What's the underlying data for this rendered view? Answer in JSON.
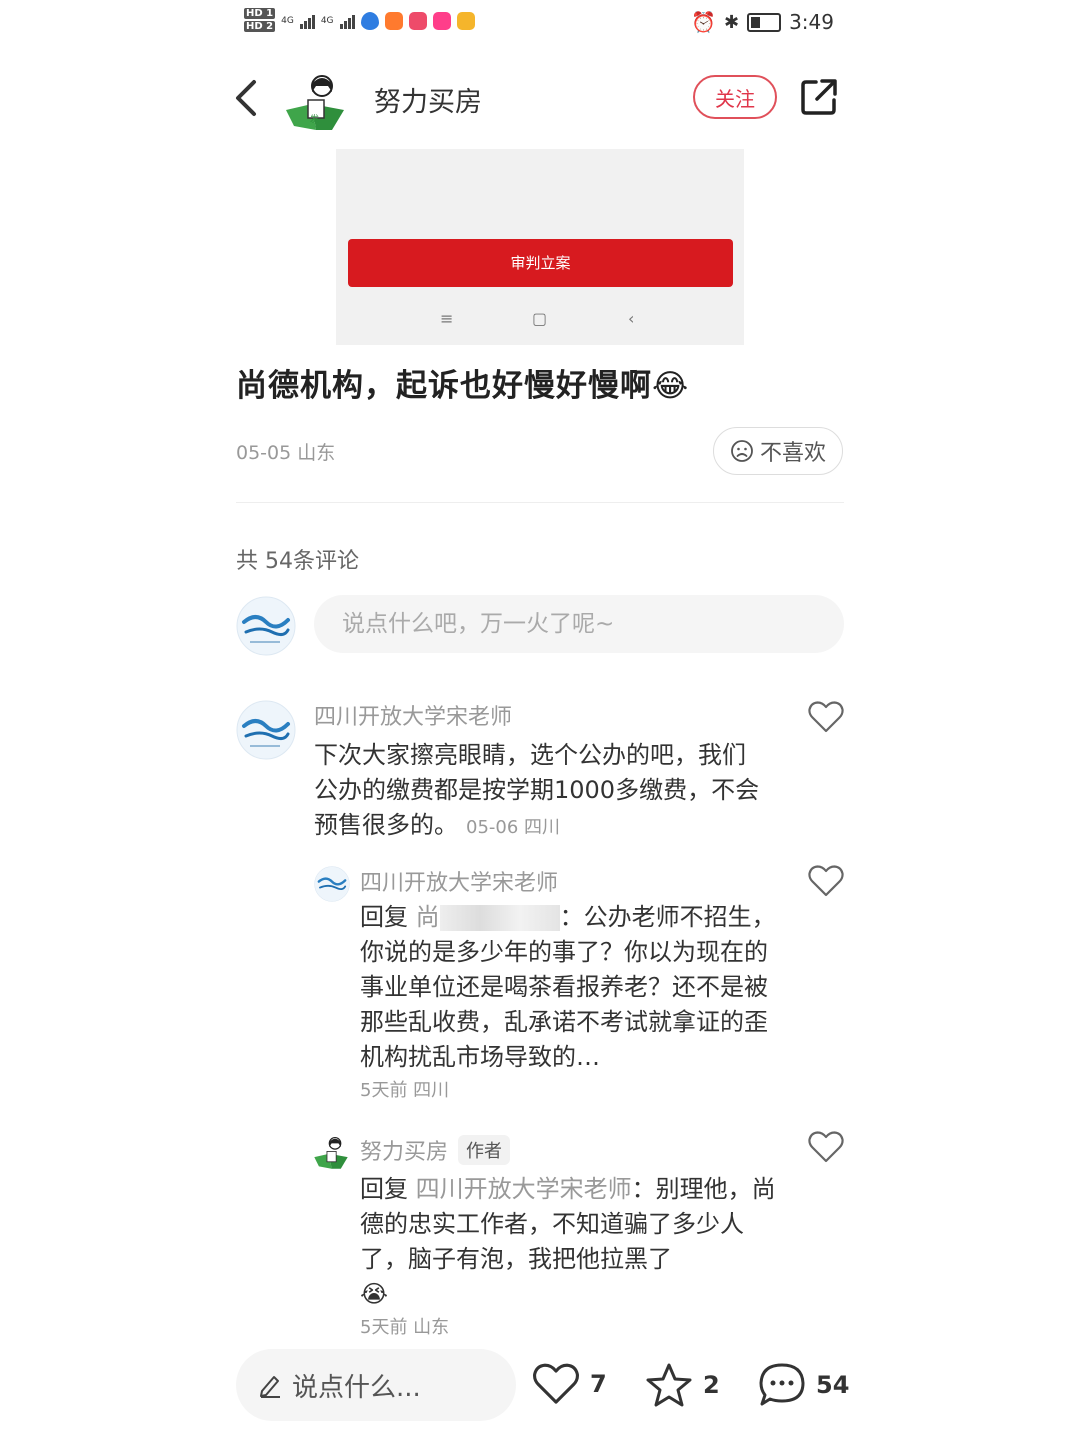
{
  "status_bar": {
    "time": "3:49",
    "hd1": "HD 1",
    "hd2": "HD 2",
    "net1": "4G",
    "net2": "4G"
  },
  "header": {
    "author_name": "努力买房",
    "follow_label": "关注",
    "back_icon": "back-chevron-icon",
    "share_icon": "share-icon"
  },
  "post_image": {
    "button_label": "审判立案",
    "nav_menu": "≡",
    "nav_home": "▢",
    "nav_back": "‹"
  },
  "post": {
    "title": "尚德机构，起诉也好慢好慢啊😂",
    "meta": "05-05 山东",
    "dislike_label": "不喜欢"
  },
  "comments_section": {
    "count_label": "共 54条评论",
    "input_placeholder": "说点什么吧，万一火了呢~"
  },
  "comments": [
    {
      "name": "四川开放大学宋老师",
      "text": "下次大家擦亮眼睛，选个公办的吧，我们公办的缴费都是按学期1000多缴费，不会预售很多的。",
      "meta": "05-06 四川"
    },
    {
      "name": "四川开放大学宋老师",
      "reply_prefix": "回复",
      "reply_to": "尚",
      "text": "：公办老师不招生，你说的是多少年的事了？你以为现在的事业单位还是喝茶看报养老？还不是被那些乱收费，乱承诺不考试就拿证的歪机构扰乱市场导致的…",
      "meta": "5天前  四川"
    },
    {
      "name": "努力买房",
      "tag": "作者",
      "reply_prefix": "回复",
      "reply_to": "四川开放大学宋老师",
      "text": "：别理他，尚德的忠实工作者，不知道骗了多少人了，脑子有泡，我把他拉黑了",
      "emoji": "😭",
      "meta": "5天前  山东"
    }
  ],
  "bottom_bar": {
    "input_label": "说点什么...",
    "likes": "7",
    "stars": "2",
    "comments": "54"
  },
  "colors": {
    "accent_red": "#e0364a",
    "image_button_red": "#d71a1f"
  }
}
